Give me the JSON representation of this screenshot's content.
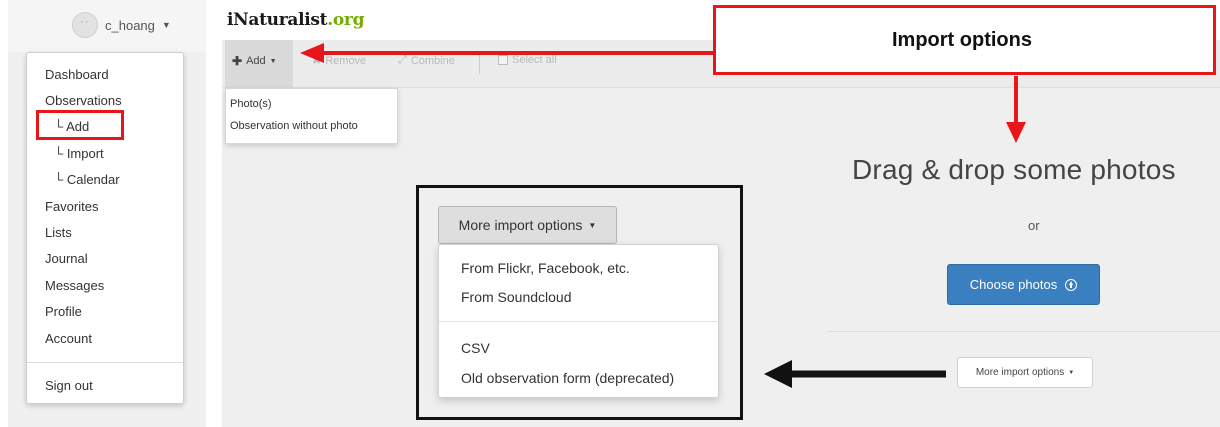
{
  "user_menu": {
    "username": "c_hoang",
    "items": [
      {
        "label": "Dashboard"
      },
      {
        "label": "Observations"
      },
      {
        "label": "└ Add"
      },
      {
        "label": "└ Import"
      },
      {
        "label": "└ Calendar"
      },
      {
        "label": "Favorites"
      },
      {
        "label": "Lists"
      },
      {
        "label": "Journal"
      },
      {
        "label": "Messages"
      },
      {
        "label": "Profile"
      },
      {
        "label": "Account"
      }
    ],
    "sign_out": "Sign out"
  },
  "app": {
    "logo_main": "iNaturalist",
    "logo_tld": ".org",
    "toolbar": {
      "add": "Add",
      "remove": "Remove",
      "combine": "Combine",
      "select_all": "Select all"
    },
    "add_dropdown": [
      "Photo(s)",
      "Observation without photo"
    ],
    "drop_title": "Drag & drop some photos",
    "or": "or",
    "choose_photos": "Choose photos",
    "more_import_small": "More import options"
  },
  "highlight": {
    "more_import_button": "More import options",
    "options_group1": [
      "From Flickr, Facebook, etc.",
      "From Soundcloud"
    ],
    "options_group2": [
      "CSV",
      "Old observation form (deprecated)"
    ]
  },
  "annotation": {
    "callout_text": "Import options",
    "red": "#e8151b",
    "black": "#111111"
  },
  "colors": {
    "brand_green": "#74ac00",
    "button_blue": "#3a7fc0"
  }
}
